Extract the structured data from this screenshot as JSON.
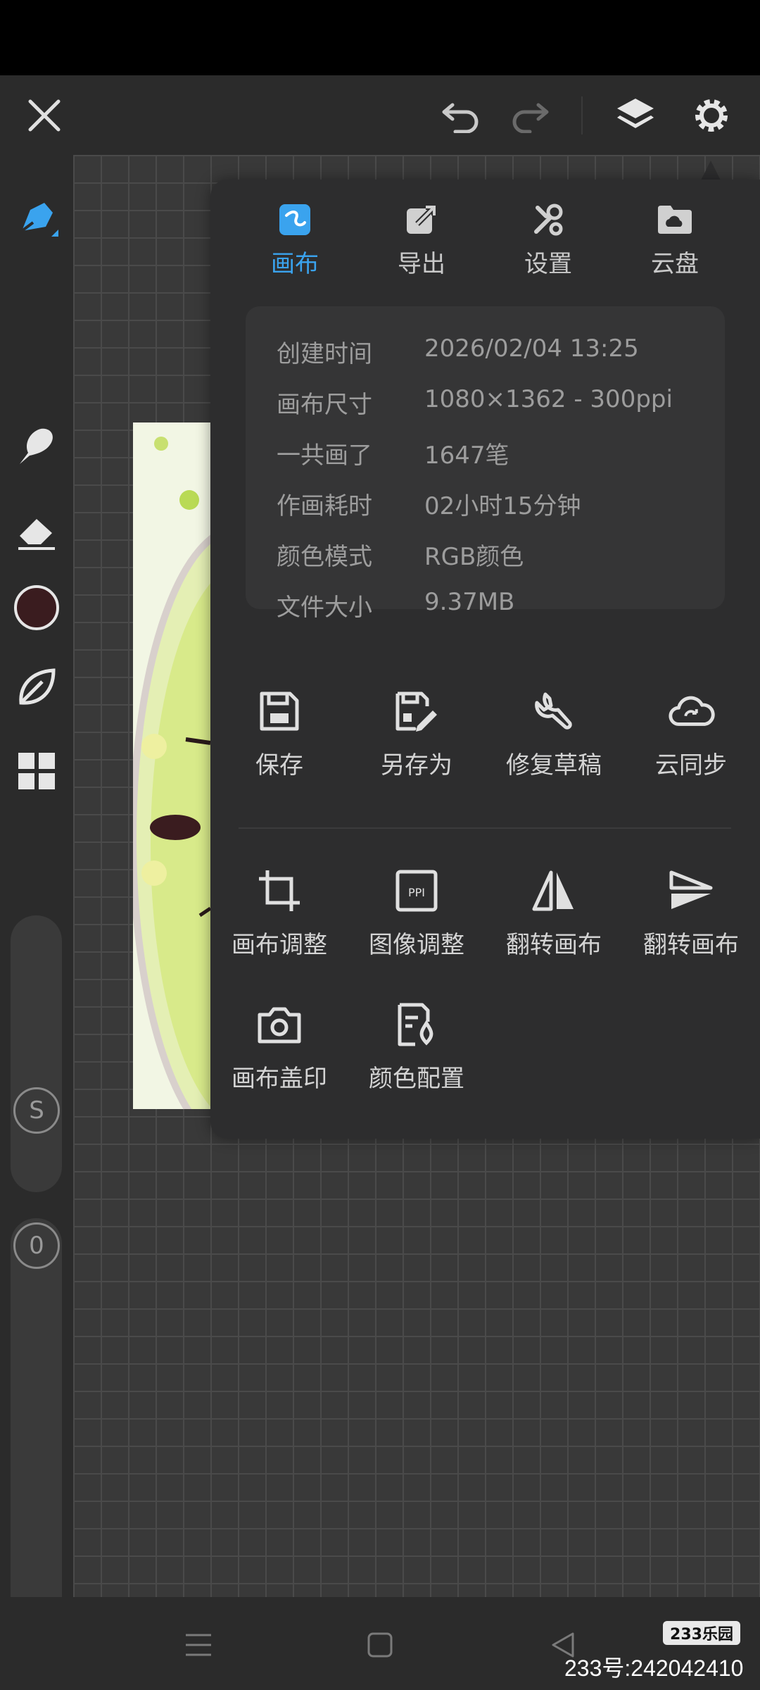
{
  "colors": {
    "accent": "#3aa3ee",
    "panel_bg": "#2d2d2e",
    "info_bg": "#353536",
    "toolbar_bg": "#2b2b2b",
    "canvas_bg": "#393939",
    "brush_color": "#3a1c1f"
  },
  "topbar": {
    "icons": [
      "close-icon",
      "undo-icon",
      "redo-icon",
      "layers-icon",
      "gear-icon"
    ]
  },
  "left_toolbar": {
    "tools": [
      "pen-icon",
      "smudge-icon",
      "eraser-icon",
      "color-swatch",
      "leaf-icon",
      "grid-icon"
    ],
    "size_knob": "S",
    "opacity_knob": "0"
  },
  "panel": {
    "tabs": [
      {
        "label": "画布",
        "icon": "canvas-icon",
        "active": true
      },
      {
        "label": "导出",
        "icon": "export-icon",
        "active": false
      },
      {
        "label": "设置",
        "icon": "tools-icon",
        "active": false
      },
      {
        "label": "云盘",
        "icon": "cloud-folder-icon",
        "active": false
      }
    ],
    "info": [
      {
        "key": "创建时间",
        "value": "2026/02/04 13:25"
      },
      {
        "key": "画布尺寸",
        "value": "1080×1362 - 300ppi"
      },
      {
        "key": "一共画了",
        "value": "1647笔"
      },
      {
        "key": "作画耗时",
        "value": "02小时15分钟"
      },
      {
        "key": "颜色模式",
        "value": "RGB颜色"
      },
      {
        "key": "文件大小",
        "value": "9.37MB"
      }
    ],
    "actions_row1": [
      {
        "label": "保存",
        "icon": "save-icon"
      },
      {
        "label": "另存为",
        "icon": "save-as-icon"
      },
      {
        "label": "修复草稿",
        "icon": "wrench-icon"
      },
      {
        "label": "云同步",
        "icon": "cloud-sync-icon"
      }
    ],
    "actions_row2": [
      {
        "label": "画布调整",
        "icon": "crop-icon"
      },
      {
        "label": "图像调整",
        "icon": "ppi-icon"
      },
      {
        "label": "翻转画布",
        "icon": "flip-horizontal-icon"
      },
      {
        "label": "翻转画布",
        "icon": "flip-vertical-icon"
      }
    ],
    "actions_row3": [
      {
        "label": "画布盖印",
        "icon": "camera-icon"
      },
      {
        "label": "颜色配置",
        "icon": "color-config-icon"
      }
    ]
  },
  "watermark": {
    "logo": "233乐园",
    "text": "233号:242042410"
  }
}
